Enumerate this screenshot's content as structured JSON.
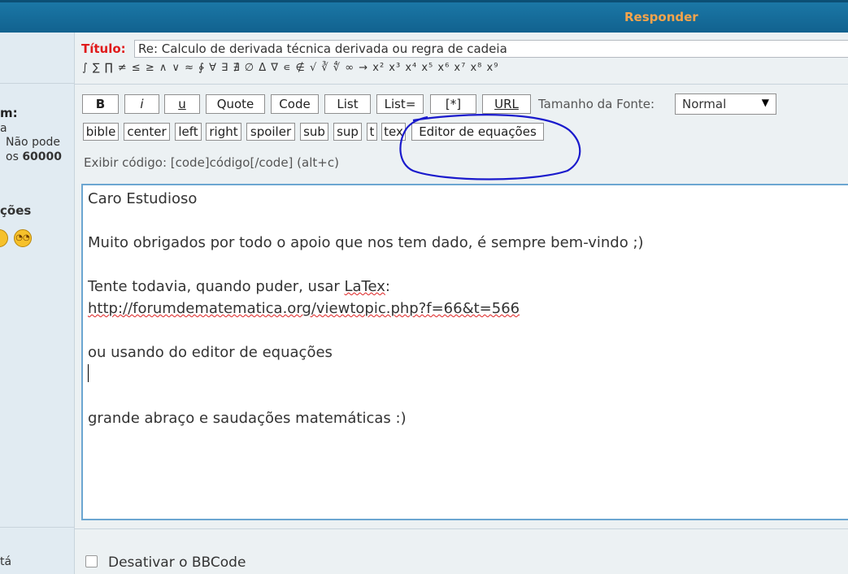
{
  "header": {
    "title": "Responder"
  },
  "sidebar": {
    "heading_fragment": "m:",
    "line_a": "a",
    "line_nao_pode": "Não pode",
    "line_os_prefix": "os",
    "line_os_number": "60000",
    "section_fragment": "ções",
    "bottom_fragment": "tá"
  },
  "form": {
    "title_label": "Título:",
    "title_value": "Re: Calculo de derivada técnica derivada ou regra de cadeia",
    "symbols": "∫ ∑ ∏ ≠ ≤ ≥ ∧ ∨ ≈ ∲ ∀ ∃ ∄ ∅ Δ ∇ ∊ ∉ √ ∛ ∜ ∞ → x² x³ x⁴ x⁵ x⁶ x⁷ x⁸ x⁹",
    "toolbar_row1": {
      "bold": "B",
      "italic": "i",
      "underline": "u",
      "quote": "Quote",
      "code": "Code",
      "list": "List",
      "list_eq": "List=",
      "list_item": "[*]",
      "url": "URL"
    },
    "font_size_label": "Tamanho da Fonte:",
    "font_size_value": "Normal",
    "toolbar_row2": {
      "bible": "bible",
      "center": "center",
      "left": "left",
      "right": "right",
      "spoiler": "spoiler",
      "sub": "sub",
      "sup": "sup",
      "t": "t",
      "tex": "tex",
      "equation_editor": "Editor de equações"
    },
    "code_hint": "Exibir código: [code]código[/code]  (alt+c)",
    "message": {
      "line1": "Caro Estudioso",
      "line2": "Muito obrigados por todo o apoio que nos tem dado, é sempre bem-vindo ;)",
      "line3_prefix": "Tente todavia, quando puder, usar ",
      "line3_latex": "LaTex",
      "line3_suffix": ":",
      "line4_link": "http://forumdematematica.org/viewtopic.php?f=66&t=566",
      "line5": "ou usando do editor de equações",
      "line6": "grande abraço e saudações matemáticas :)"
    },
    "disable_bbcode_label": "Desativar o BBCode"
  },
  "colors": {
    "header_bg": "#1B77A6",
    "header_text": "#F5A44C",
    "title_label": "#E01B1B",
    "annotation": "#1A1ACC"
  }
}
